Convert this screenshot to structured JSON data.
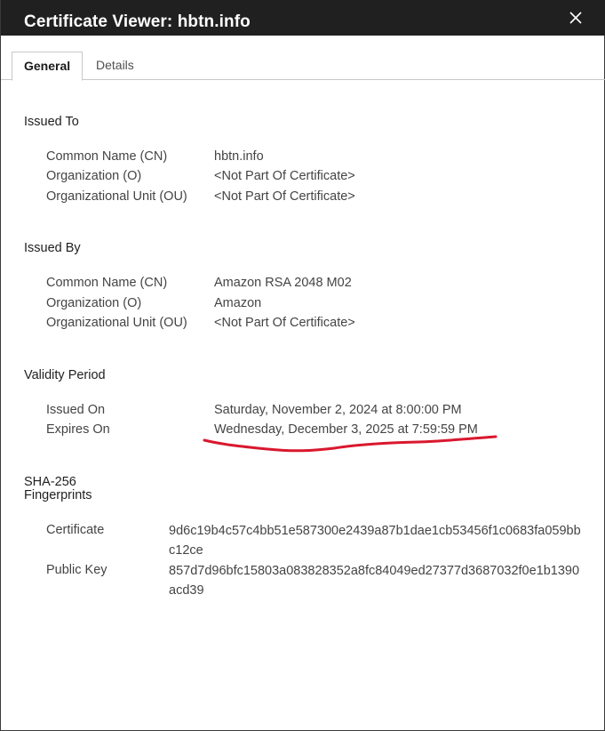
{
  "window": {
    "title": "Certificate Viewer: hbtn.info"
  },
  "tabs": [
    {
      "label": "General"
    },
    {
      "label": "Details"
    }
  ],
  "issued_to": {
    "heading": "Issued To",
    "rows": [
      {
        "label": "Common Name (CN)",
        "value": "hbtn.info"
      },
      {
        "label": "Organization (O)",
        "value": "<Not Part Of Certificate>"
      },
      {
        "label": "Organizational Unit (OU)",
        "value": "<Not Part Of Certificate>"
      }
    ]
  },
  "issued_by": {
    "heading": "Issued By",
    "rows": [
      {
        "label": "Common Name (CN)",
        "value": "Amazon RSA 2048 M02"
      },
      {
        "label": "Organization (O)",
        "value": "Amazon"
      },
      {
        "label": "Organizational Unit (OU)",
        "value": "<Not Part Of Certificate>"
      }
    ]
  },
  "validity": {
    "heading": "Validity Period",
    "rows": [
      {
        "label": "Issued On",
        "value": "Saturday, November 2, 2024 at 8:00:00 PM"
      },
      {
        "label": "Expires On",
        "value": "Wednesday, December 3, 2025 at 7:59:59 PM"
      }
    ]
  },
  "fingerprints": {
    "heading_line1": "SHA-256",
    "heading_line2": "Fingerprints",
    "rows": [
      {
        "label": "Certificate",
        "value": "9d6c19b4c57c4bb51e587300e2439a87b1dae1cb53456f1c0683fa059bbc12ce"
      },
      {
        "label": "Public Key",
        "value": "857d7d96bfc15803a083828352a8fc84049ed27377d3687032f0e1b1390acd39"
      }
    ]
  },
  "annotation": {
    "color": "#d9182e"
  },
  "icons": {
    "close": "close-icon"
  }
}
